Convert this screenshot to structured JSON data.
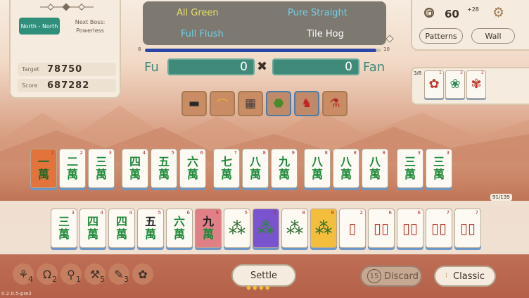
{
  "round": {
    "label": "North - North"
  },
  "boss": {
    "title": "Next Boss:",
    "name": "Powerless"
  },
  "target": {
    "label": "Target",
    "value": "78750"
  },
  "score": {
    "label": "Score",
    "value": "687282"
  },
  "hands": [
    {
      "name": "All Green",
      "color": "#e8e06a"
    },
    {
      "name": "Pure Straight",
      "color": "#6fd0e6"
    },
    {
      "name": "Full Flush",
      "color": "#6fd0e6"
    },
    {
      "name": "Tile Hog",
      "color": "#ffffff"
    }
  ],
  "progress": {
    "min": "8",
    "max": "10",
    "fraction": 0.98
  },
  "fu": {
    "label": "Fu",
    "value": "0"
  },
  "fan": {
    "label": "Fan",
    "value": "0"
  },
  "times": "✖",
  "money": {
    "value": "60",
    "plus": "+28"
  },
  "buttons": {
    "patterns": "Patterns",
    "wall": "Wall",
    "settle": "Settle",
    "discard": "Discard",
    "discard_count": "15",
    "classic": "Classic"
  },
  "bonus": {
    "count": "3/8",
    "tiles": [
      {
        "glyph": "✿",
        "num": "1",
        "color": "#c0392b"
      },
      {
        "glyph": "❀",
        "num": "3",
        "color": "#2e8b57"
      },
      {
        "glyph": "✾",
        "num": "2",
        "color": "#c0392b"
      }
    ]
  },
  "relics": [
    {
      "icon": "sunglasses-icon",
      "glyph": "▬",
      "color": "#2a2a2a",
      "style": "orange"
    },
    {
      "icon": "bananas-icon",
      "glyph": "⌒",
      "color": "#e2b431",
      "style": "orange"
    },
    {
      "icon": "abacus-icon",
      "glyph": "▦",
      "color": "#3a3a3a",
      "style": "orange"
    },
    {
      "icon": "green-sack-icon",
      "glyph": "⬣",
      "color": "#4a8a2a",
      "style": "blue"
    },
    {
      "icon": "red-bird-icon",
      "glyph": "♞",
      "color": "#c02020",
      "style": "blue"
    },
    {
      "icon": "potion-icon",
      "glyph": "⚗",
      "color": "#b02a2a",
      "style": "orange"
    }
  ],
  "melds": [
    {
      "top": "一",
      "num": "1",
      "style": "selected"
    },
    {
      "top": "二",
      "num": "2",
      "style": ""
    },
    {
      "top": "三",
      "num": "3",
      "style": ""
    },
    {
      "top": "四",
      "num": "4",
      "style": ""
    },
    {
      "top": "五",
      "num": "5",
      "style": ""
    },
    {
      "top": "六",
      "num": "6",
      "style": ""
    },
    {
      "top": "七",
      "num": "7",
      "style": ""
    },
    {
      "top": "八",
      "num": "8",
      "style": ""
    },
    {
      "top": "九",
      "num": "9",
      "style": ""
    },
    {
      "top": "八",
      "num": "8",
      "style": ""
    },
    {
      "top": "八",
      "num": "8",
      "style": ""
    },
    {
      "top": "八",
      "num": "8",
      "style": ""
    },
    {
      "top": "三",
      "num": "3",
      "style": ""
    },
    {
      "top": "三",
      "num": "3",
      "style": ""
    }
  ],
  "meld_char": "萬",
  "wall_count": "91/139",
  "hand": [
    {
      "top": "三",
      "bot": "萬",
      "num": "3",
      "style": ""
    },
    {
      "top": "四",
      "bot": "萬",
      "num": "4",
      "style": ""
    },
    {
      "top": "四",
      "bot": "萬",
      "num": "4",
      "style": ""
    },
    {
      "top": "五",
      "bot": "萬",
      "num": "5",
      "style": "black"
    },
    {
      "top": "六",
      "bot": "萬",
      "num": "6",
      "style": ""
    },
    {
      "top": "九",
      "bot": "萬",
      "num": "9",
      "style": "red"
    },
    {
      "top": "⁂",
      "bot": "",
      "num": "5",
      "style": "bamboo"
    },
    {
      "top": "⁂",
      "bot": "",
      "num": "5",
      "style": "purple"
    },
    {
      "top": "⁂",
      "bot": "",
      "num": "8",
      "style": "bamboo"
    },
    {
      "top": "⁂",
      "bot": "",
      "num": "8",
      "style": "gold"
    },
    {
      "top": "▯",
      "bot": "",
      "num": "2",
      "style": "pin"
    },
    {
      "top": "▯▯",
      "bot": "",
      "num": "6",
      "style": "pin"
    },
    {
      "top": "▯▯",
      "bot": "",
      "num": "6",
      "style": "pin"
    },
    {
      "top": "▯▯",
      "bot": "",
      "num": "7",
      "style": "pin"
    },
    {
      "top": "▯▯",
      "bot": "",
      "num": "7",
      "style": "pin"
    }
  ],
  "tools": [
    {
      "name": "tool-1",
      "glyph": "⚘",
      "count": "4"
    },
    {
      "name": "tool-2",
      "glyph": "Ω",
      "count": "2"
    },
    {
      "name": "tool-3",
      "glyph": "⚲",
      "count": "1"
    },
    {
      "name": "tool-4",
      "glyph": "⚒",
      "count": "5"
    },
    {
      "name": "tool-5",
      "glyph": "✎",
      "count": "3"
    },
    {
      "name": "tool-6",
      "glyph": "✿",
      "count": ""
    }
  ],
  "version": "0.2.0.5-pre2"
}
